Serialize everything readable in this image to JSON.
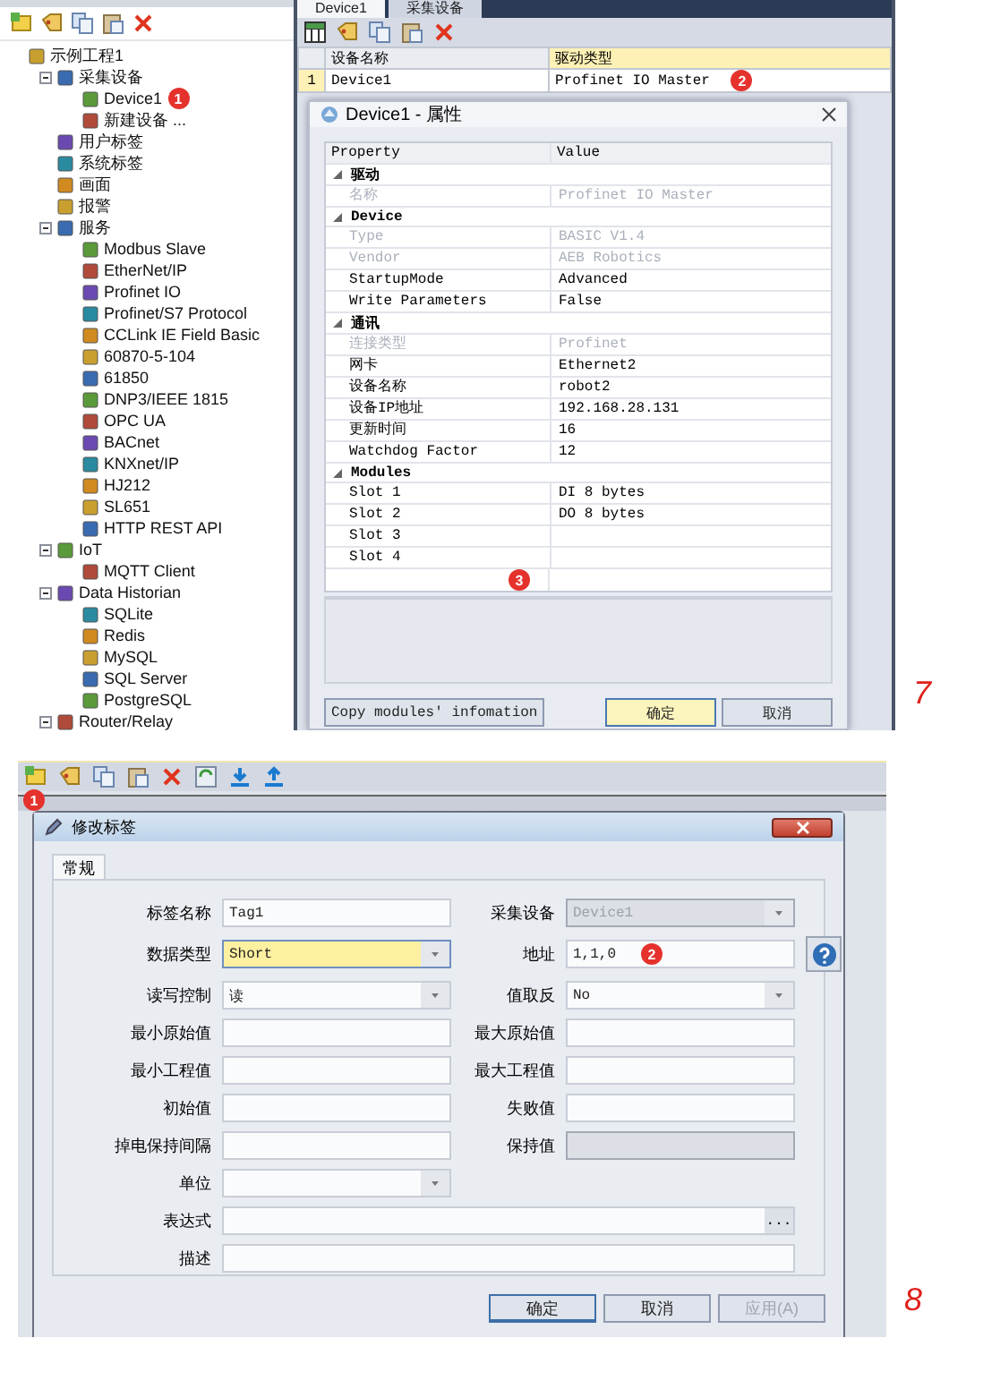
{
  "tree": {
    "items": [
      {
        "label": "示例工程1",
        "children": [
          {
            "label": "采集设备",
            "expanded": true,
            "children": [
              {
                "label": "Device1",
                "badge": "1"
              },
              {
                "label": "新建设备 ..."
              }
            ]
          },
          {
            "label": "用户标签"
          },
          {
            "label": "系统标签"
          },
          {
            "label": "画面"
          },
          {
            "label": "报警"
          },
          {
            "label": "服务",
            "expanded": true,
            "children": [
              {
                "label": "Modbus Slave"
              },
              {
                "label": "EtherNet/IP"
              },
              {
                "label": "Profinet IO"
              },
              {
                "label": "Profinet/S7 Protocol"
              },
              {
                "label": "CCLink IE Field Basic"
              },
              {
                "label": "60870-5-104"
              },
              {
                "label": "61850"
              },
              {
                "label": "DNP3/IEEE 1815"
              },
              {
                "label": "OPC UA"
              },
              {
                "label": "BACnet"
              },
              {
                "label": "KNXnet/IP"
              },
              {
                "label": "HJ212"
              },
              {
                "label": "SL651"
              },
              {
                "label": "HTTP REST API"
              }
            ]
          },
          {
            "label": "IoT",
            "expanded": true,
            "children": [
              {
                "label": "MQTT Client"
              }
            ]
          },
          {
            "label": "Data Historian",
            "expanded": true,
            "children": [
              {
                "label": "SQLite"
              },
              {
                "label": "Redis"
              },
              {
                "label": "MySQL"
              },
              {
                "label": "SQL Server"
              },
              {
                "label": "PostgreSQL"
              }
            ]
          },
          {
            "label": "Router/Relay",
            "expanded": true
          }
        ]
      }
    ]
  },
  "editor": {
    "tabs": [
      {
        "label": "Device1",
        "selected": true
      },
      {
        "label": "采集设备",
        "selected": false
      }
    ],
    "grid": {
      "columns": [
        {
          "label": "设备名称",
          "selected": false
        },
        {
          "label": "驱动类型",
          "selected": true
        }
      ],
      "rows": [
        {
          "number": "1",
          "cells": [
            "Device1",
            "Profinet IO Master"
          ],
          "badge": "2"
        }
      ]
    },
    "dialog": {
      "title": "Device1 - 属性",
      "columns": [
        "Property",
        "Value"
      ],
      "groups": [
        {
          "name": "驱动",
          "expanded": true,
          "rows": [
            {
              "property": "名称",
              "value": "Profinet IO Master",
              "disabled": true
            }
          ]
        },
        {
          "name": "Device",
          "expanded": true,
          "rows": [
            {
              "property": "Type",
              "value": "BASIC V1.4",
              "disabled": true
            },
            {
              "property": "Vendor",
              "value": "AEB Robotics",
              "disabled": true
            },
            {
              "property": "StartupMode",
              "value": "Advanced",
              "disabled": false
            },
            {
              "property": "Write Parameters",
              "value": "False",
              "disabled": false
            }
          ]
        },
        {
          "name": "通讯",
          "expanded": true,
          "rows": [
            {
              "property": "连接类型",
              "value": "Profinet",
              "disabled": true
            },
            {
              "property": "网卡",
              "value": "Ethernet2",
              "disabled": false
            },
            {
              "property": "设备名称",
              "value": "robot2",
              "disabled": false
            },
            {
              "property": "设备IP地址",
              "value": "192.168.28.131",
              "disabled": false
            },
            {
              "property": "更新时间",
              "value": "16",
              "disabled": false
            },
            {
              "property": "Watchdog Factor",
              "value": "12",
              "disabled": false
            }
          ]
        },
        {
          "name": "Modules",
          "expanded": true,
          "rows": [
            {
              "property": "Slot 1",
              "value": "DI 8 bytes",
              "disabled": false
            },
            {
              "property": "Slot 2",
              "value": "DO 8 bytes",
              "disabled": false
            },
            {
              "property": "Slot 3",
              "disabled": false
            },
            {
              "property": "Slot 4",
              "disabled": false
            }
          ]
        }
      ],
      "badge": "3",
      "copy_button": "Copy modules' infomation",
      "buttons": [
        {
          "label": "确定",
          "default": true
        },
        {
          "label": "取消",
          "default": false
        }
      ]
    }
  },
  "figure_7": "7",
  "tag_window": {
    "badge": "1",
    "dialog": {
      "title": "修改标签",
      "tabs": [
        {
          "label": "常规",
          "selected": true
        }
      ],
      "rows": [
        {
          "fields": [
            {
              "label": "标签名称",
              "kind": "text",
              "value": "Tag1",
              "focused": false,
              "disabled": false,
              "help": false
            },
            {
              "label": "采集设备",
              "kind": "dropdown",
              "value": "Device1",
              "focused": false,
              "disabled": true,
              "help": false
            }
          ]
        },
        {
          "fields": [
            {
              "label": "数据类型",
              "kind": "dropdown",
              "value": "Short",
              "focused": true,
              "disabled": false,
              "help": false
            },
            {
              "label": "地址",
              "kind": "text",
              "value": "1,1,0",
              "badge": "2",
              "focused": false,
              "disabled": false,
              "help": true
            }
          ]
        },
        {
          "fields": [
            {
              "label": "读写控制",
              "kind": "dropdown",
              "value": "读",
              "focused": false,
              "disabled": false,
              "help": false
            },
            {
              "label": "值取反",
              "kind": "dropdown",
              "value": "No",
              "focused": false,
              "disabled": false,
              "help": false
            }
          ]
        },
        {
          "fields": [
            {
              "label": "最小原始值",
              "kind": "text",
              "focused": false,
              "disabled": false,
              "help": false
            },
            {
              "label": "最大原始值",
              "kind": "text",
              "focused": false,
              "disabled": false,
              "help": false
            }
          ]
        },
        {
          "fields": [
            {
              "label": "最小工程值",
              "kind": "text",
              "focused": false,
              "disabled": false,
              "help": false
            },
            {
              "label": "最大工程值",
              "kind": "text",
              "focused": false,
              "disabled": false,
              "help": false
            }
          ]
        },
        {
          "fields": [
            {
              "label": "初始值",
              "kind": "text",
              "focused": false,
              "disabled": false,
              "help": false
            },
            {
              "label": "失败值",
              "kind": "text",
              "focused": false,
              "disabled": false,
              "help": false
            }
          ]
        },
        {
          "fields": [
            {
              "label": "掉电保持间隔",
              "kind": "text",
              "focused": false,
              "disabled": false,
              "help": false
            },
            {
              "label": "保持值",
              "kind": "text",
              "focused": false,
              "disabled": true,
              "help": false
            }
          ]
        },
        {
          "fields": [
            {
              "label": "单位",
              "kind": "dropdown",
              "focused": false,
              "disabled": false,
              "help": false
            }
          ]
        },
        {
          "fields": [
            {
              "label": "表达式",
              "kind": "text",
              "browse": "...",
              "wide": true,
              "focused": false,
              "disabled": false,
              "help": false
            }
          ]
        },
        {
          "fields": [
            {
              "label": "描述",
              "kind": "text",
              "wide": true,
              "focused": false,
              "disabled": false,
              "help": false
            }
          ]
        }
      ],
      "buttons": [
        {
          "label": "确定",
          "default": true,
          "disabled": false
        },
        {
          "label": "取消",
          "default": false,
          "disabled": false
        },
        {
          "label": "应用(A)",
          "default": false,
          "disabled": true
        }
      ]
    }
  },
  "figure_8": "8"
}
